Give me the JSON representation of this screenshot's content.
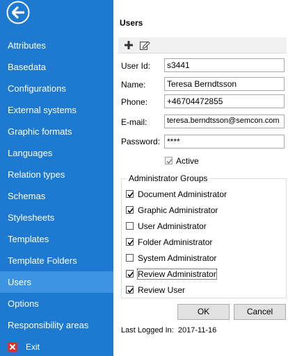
{
  "sidebar": {
    "items": [
      {
        "label": "Attributes"
      },
      {
        "label": "Basedata"
      },
      {
        "label": "Configurations"
      },
      {
        "label": "External systems"
      },
      {
        "label": "Graphic formats"
      },
      {
        "label": "Languages"
      },
      {
        "label": "Relation types"
      },
      {
        "label": "Schemas"
      },
      {
        "label": "Stylesheets"
      },
      {
        "label": "Templates"
      },
      {
        "label": "Template Folders"
      },
      {
        "label": "Users",
        "active": true
      },
      {
        "label": "Options"
      },
      {
        "label": "Responsibility areas"
      }
    ],
    "exit_label": "Exit",
    "back_icon": "back-arrow-icon",
    "accent": "#1e79d1",
    "active_color": "#3d94e3"
  },
  "panel": {
    "title": "Users",
    "toolbar": {
      "add_icon": "plus-icon",
      "edit_icon": "edit-icon"
    }
  },
  "form": {
    "user_id_label": "User Id:",
    "user_id": "s3441",
    "name_label": "Name:",
    "name": "Teresa Berndtsson",
    "phone_label": "Phone:",
    "phone": "+46704472855",
    "email_label": "E-mail:",
    "email": "teresa.berndtsson@semcon.com",
    "password_label": "Password:",
    "password": "****",
    "active_label": "Active",
    "active": true
  },
  "groups": {
    "title": "Administrator Groups",
    "items": [
      {
        "label": "Document Administrator",
        "checked": true
      },
      {
        "label": "Graphic Administrator",
        "checked": true
      },
      {
        "label": "User Administrator",
        "checked": false
      },
      {
        "label": "Folder Administrator",
        "checked": true
      },
      {
        "label": "System Administrator",
        "checked": false
      },
      {
        "label": "Review Administrator",
        "checked": true
      },
      {
        "label": "Review User",
        "checked": true
      }
    ]
  },
  "buttons": {
    "ok": "OK",
    "cancel": "Cancel"
  },
  "last_logged": {
    "label": "Last Logged In:",
    "value": "2017-11-16"
  }
}
